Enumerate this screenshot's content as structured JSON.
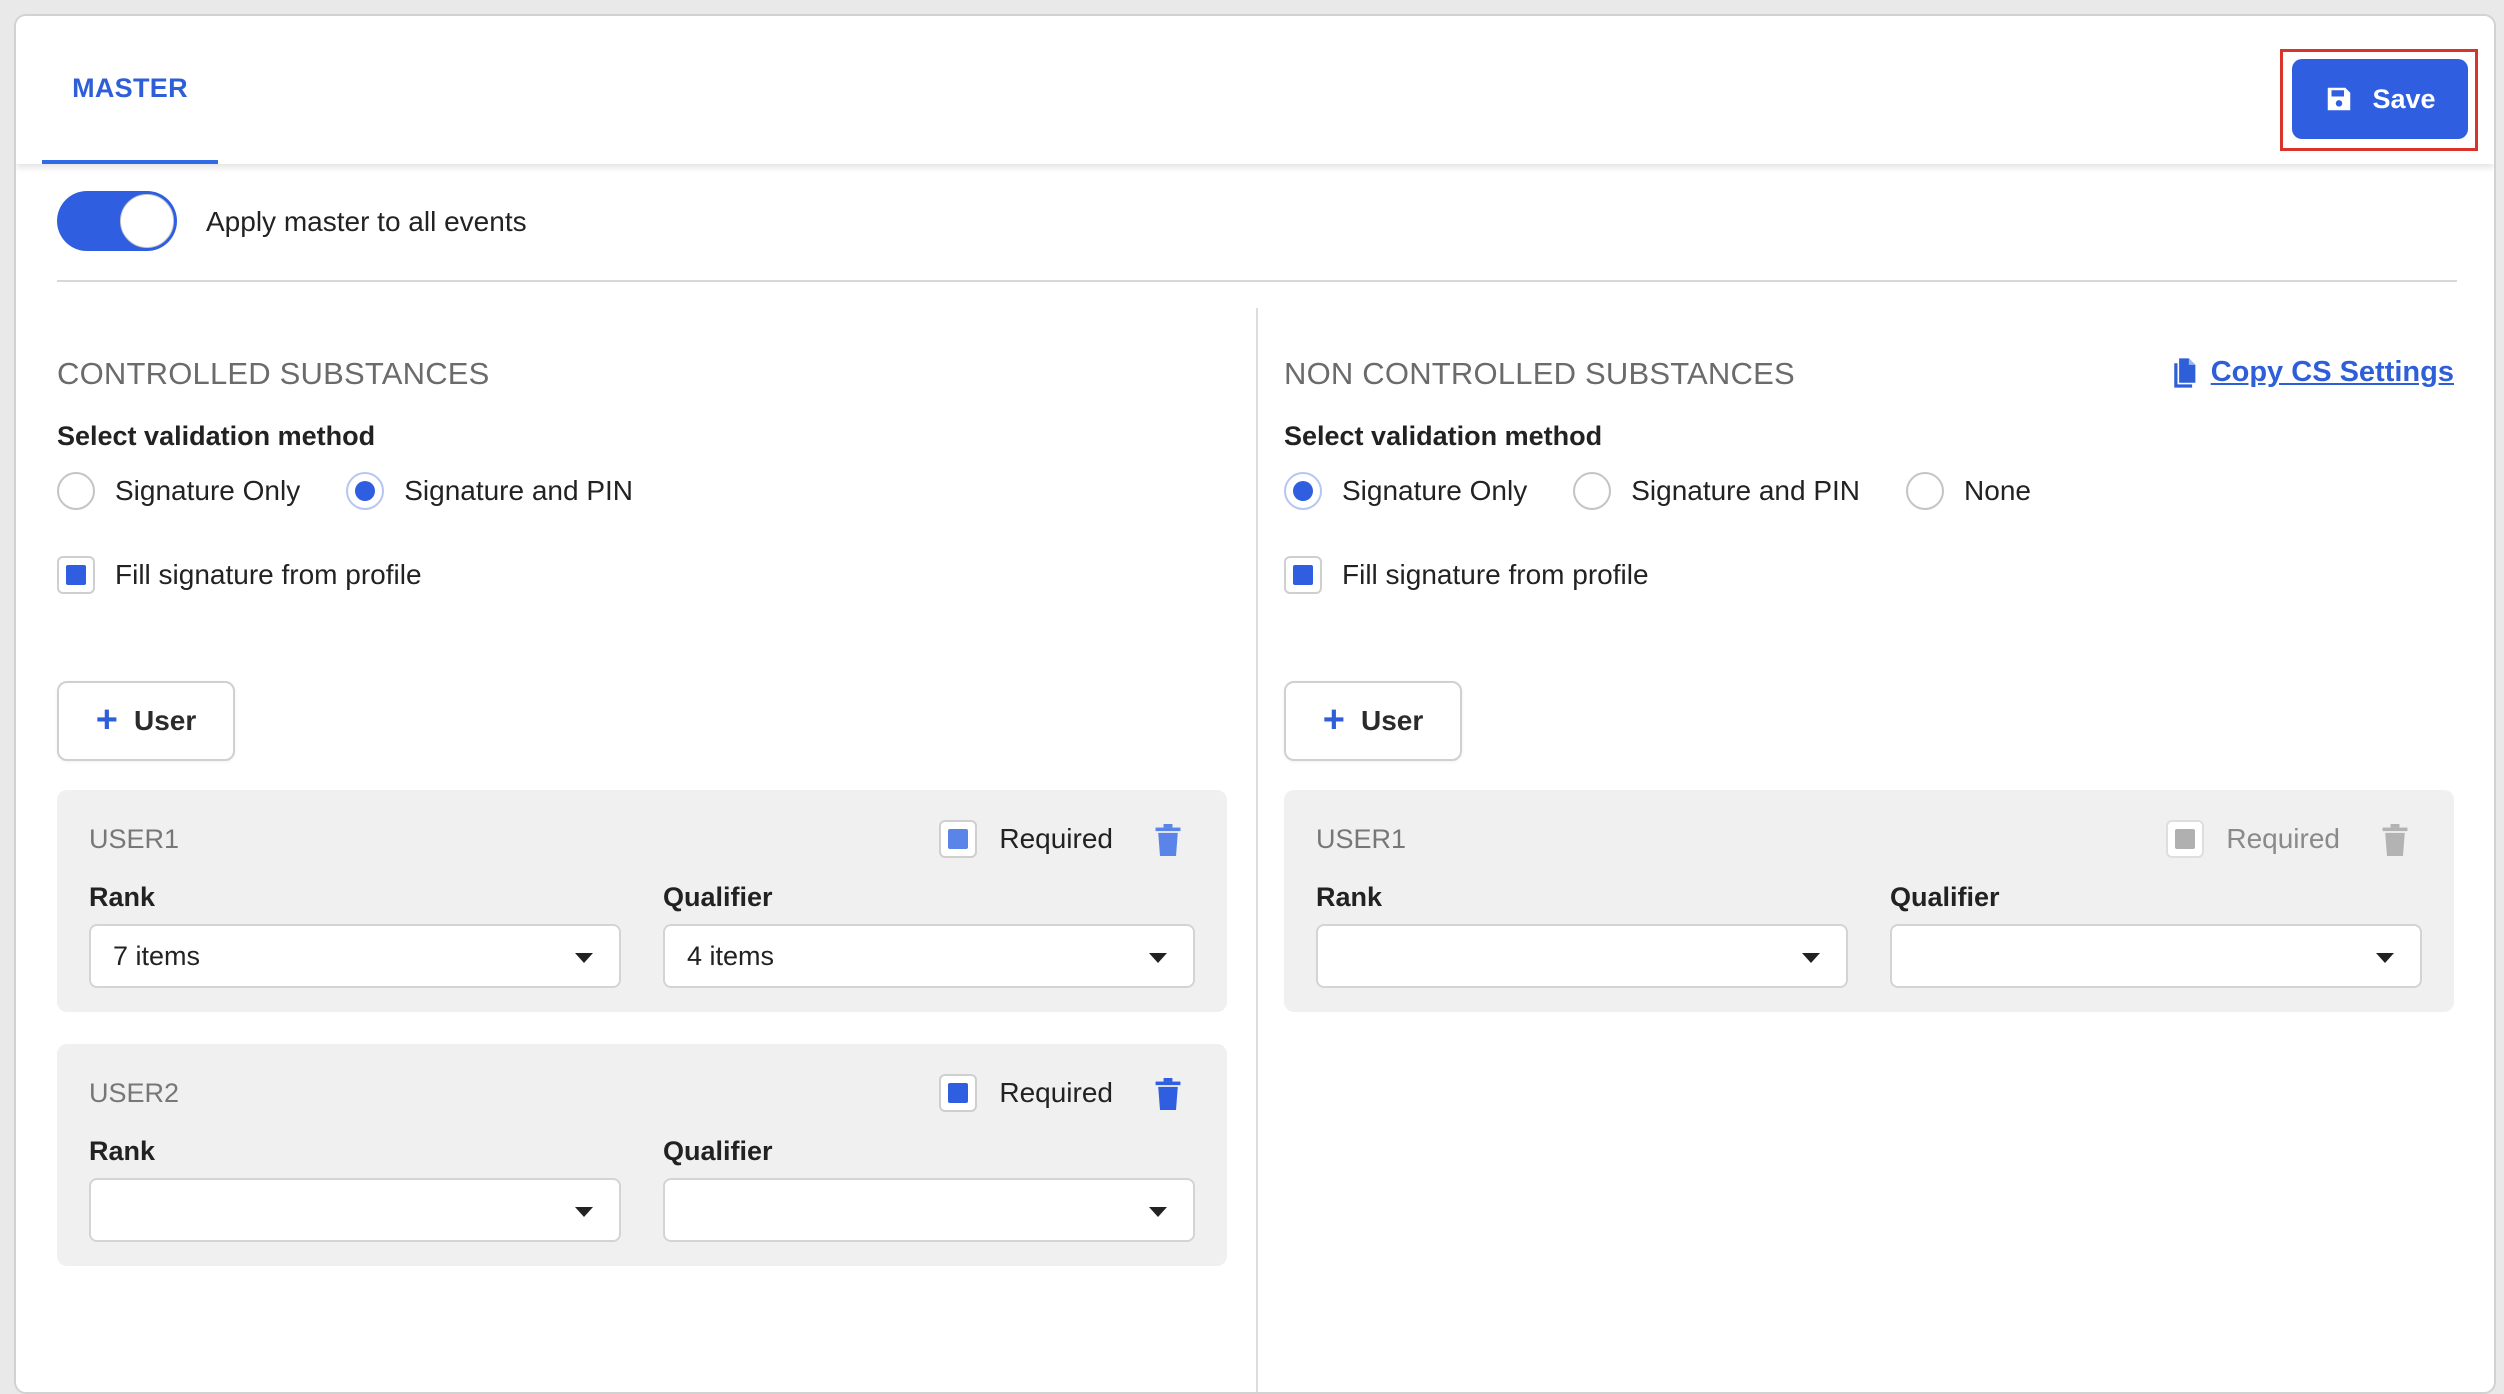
{
  "header": {
    "tab_master": "MASTER",
    "save_label": "Save"
  },
  "toggle": {
    "label": "Apply master to all events",
    "on": true
  },
  "controlled": {
    "title": "CONTROLLED SUBSTANCES",
    "select_label": "Select validation method",
    "options": [
      "Signature Only",
      "Signature and PIN"
    ],
    "selected": "Signature and PIN",
    "fill_signature_label": "Fill signature from profile",
    "add_user_label": "User",
    "users": [
      {
        "title": "USER1",
        "required_label": "Required",
        "rank_label": "Rank",
        "rank_value": "7 items",
        "qualifier_label": "Qualifier",
        "qualifier_value": "4 items"
      },
      {
        "title": "USER2",
        "required_label": "Required",
        "rank_label": "Rank",
        "rank_value": "",
        "qualifier_label": "Qualifier",
        "qualifier_value": ""
      }
    ]
  },
  "non_controlled": {
    "title": "NON CONTROLLED SUBSTANCES",
    "copy_label": "Copy CS Settings",
    "select_label": "Select validation method",
    "options": [
      "Signature Only",
      "Signature and PIN",
      "None"
    ],
    "selected": "Signature Only",
    "fill_signature_label": "Fill signature from profile",
    "add_user_label": "User",
    "users": [
      {
        "title": "USER1",
        "required_label": "Required",
        "rank_label": "Rank",
        "rank_value": "",
        "qualifier_label": "Qualifier",
        "qualifier_value": ""
      }
    ]
  },
  "colors": {
    "accent": "#2f5fe0",
    "highlight_outline": "#d9342b"
  }
}
